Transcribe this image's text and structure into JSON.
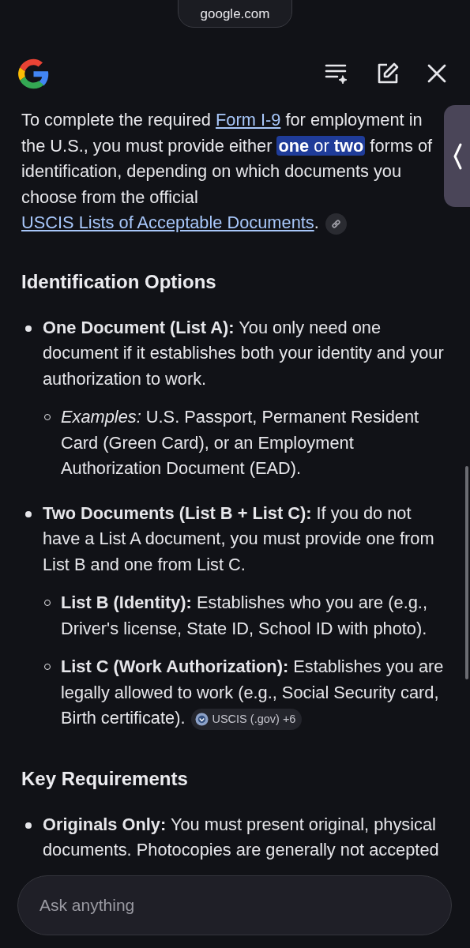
{
  "address_bar": {
    "domain": "google.com"
  },
  "intro": [
    {
      "kind": "text",
      "text": "To complete the required "
    },
    {
      "kind": "link",
      "text": "Form I-9"
    },
    {
      "kind": "text",
      "text": " for employment in the U.S., you must provide either "
    },
    {
      "kind": "highlight",
      "text": "**one** or **two**"
    },
    {
      "kind": "text",
      "text": " forms of identification, depending on which documents you choose from the official "
    },
    {
      "kind": "link",
      "text": "USCIS Lists of Acceptable Documents"
    },
    {
      "kind": "text",
      "text": "."
    },
    {
      "kind": "source_link"
    }
  ],
  "sections": [
    {
      "heading": "Identification Options",
      "items": [
        {
          "text": "**One Document (List A):** You only need one document if it establishes both your identity and your authorization to work.",
          "children": [
            {
              "text": "*Examples:* U.S. Passport, Permanent Resident Card (Green Card), or an Employment Authorization Document (EAD)."
            }
          ]
        },
        {
          "text": "**Two Documents (List B + List C):** If you do not have a List A document, you must provide one from List B and one from List C.",
          "children": [
            {
              "text": "**List B (Identity):** Establishes who you are (e.g., Driver's license, State ID, School ID with photo)."
            },
            {
              "text": "**List C (Work Authorization):** Establishes you are legally allowed to work (e.g., Social Security card, Birth certificate).",
              "source": "USCIS (.gov) +6"
            }
          ]
        }
      ]
    },
    {
      "heading": "Key Requirements",
      "items": [
        {
          "text": "**Originals Only:** You must present original, physical documents. Photocopies are generally not accepted"
        }
      ]
    }
  ],
  "input": {
    "placeholder": "Ask anything"
  }
}
